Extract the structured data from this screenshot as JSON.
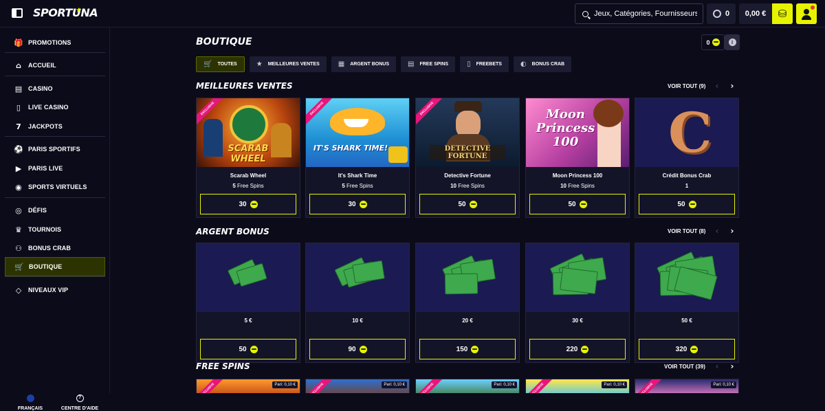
{
  "header": {
    "logo": "SPORTUNA",
    "search_placeholder": "Jeux, Catégories, Fournisseurs",
    "coins": "0",
    "balance": "0,00 €"
  },
  "sidebar": {
    "groups": [
      [
        {
          "label": "PROMOTIONS",
          "icon": "gift-icon"
        }
      ],
      [
        {
          "label": "ACCUEIL",
          "icon": "home-icon"
        }
      ],
      [
        {
          "label": "CASINO",
          "icon": "slot-icon"
        },
        {
          "label": "LIVE CASINO",
          "icon": "phone-icon"
        },
        {
          "label": "JACKPOTS",
          "icon": "seven-icon"
        }
      ],
      [
        {
          "label": "PARIS SPORTIFS",
          "icon": "ball-icon"
        },
        {
          "label": "PARIS LIVE",
          "icon": "video-icon"
        },
        {
          "label": "SPORTS VIRTUELS",
          "icon": "gamepad-icon"
        }
      ],
      [
        {
          "label": "DÉFIS",
          "icon": "target-icon"
        },
        {
          "label": "TOURNOIS",
          "icon": "trophy-icon"
        },
        {
          "label": "BONUS CRAB",
          "icon": "crab-icon"
        },
        {
          "label": "BOUTIQUE",
          "icon": "basket-icon"
        }
      ],
      [
        {
          "label": "NIVEAUX VIP",
          "icon": "diamond-icon"
        }
      ]
    ],
    "footer_language": "FRANÇAIS",
    "footer_help": "CENTRE D'AIDE"
  },
  "page": {
    "title": "BOUTIQUE",
    "wallet_count": "0",
    "tabs": [
      {
        "label": "TOUTES",
        "icon": "basket-icon",
        "active": true
      },
      {
        "label": "MEILLEURES VENTES",
        "icon": "star-icon",
        "active": false
      },
      {
        "label": "ARGENT BONUS",
        "icon": "cash-icon",
        "active": false
      },
      {
        "label": "FREE SPINS",
        "icon": "ticket-icon",
        "active": false
      },
      {
        "label": "FREEBETS",
        "icon": "slip-icon",
        "active": false
      },
      {
        "label": "BONUS CRAB",
        "icon": "crab-icon",
        "active": false
      }
    ]
  },
  "sections": {
    "best": {
      "title": "MEILLEURES VENTES",
      "voir": "VOIR TOUT (9)",
      "items": [
        {
          "name": "Scarab Wheel",
          "qty": "5",
          "unit": "Free Spins",
          "price": "30",
          "exclusive": "EXCLUSIVE"
        },
        {
          "name": "It's Shark Time",
          "qty": "5",
          "unit": "Free Spins",
          "price": "30",
          "exclusive": "EXCLUSIVE"
        },
        {
          "name": "Detective Fortune",
          "qty": "10",
          "unit": "Free Spins",
          "price": "50",
          "exclusive": "EXCLUSIVE"
        },
        {
          "name": "Moon Princess 100",
          "qty": "10",
          "unit": "Free Spins",
          "price": "50",
          "exclusive": ""
        },
        {
          "name": "Crédit Bonus Crab",
          "qty": "1",
          "unit": "",
          "price": "50",
          "exclusive": ""
        }
      ]
    },
    "money": {
      "title": "ARGENT BONUS",
      "voir": "VOIR TOUT (8)",
      "items": [
        {
          "name": "5 €",
          "price": "50"
        },
        {
          "name": "10 €",
          "price": "90"
        },
        {
          "name": "20 €",
          "price": "150"
        },
        {
          "name": "30 €",
          "price": "220"
        },
        {
          "name": "50 €",
          "price": "320"
        }
      ]
    },
    "spins": {
      "title": "FREE SPINS",
      "voir": "VOIR TOUT (39)",
      "items": [
        {
          "pari": "Pari: 0,10 €",
          "exclusive": "EXCLUSIVE"
        },
        {
          "pari": "Pari: 0,10 €",
          "exclusive": "EXCLUSIVE"
        },
        {
          "pari": "Pari: 0,10 €",
          "exclusive": "EXCLUSIVE"
        },
        {
          "pari": "Pari: 0,10 €",
          "exclusive": "EXCLUSIVE"
        },
        {
          "pari": "Pari: 0,10 €",
          "exclusive": "EXCLUSIVE"
        }
      ]
    }
  },
  "card_images": {
    "scarab": "SCARAB WHEEL",
    "shark": "IT'S SHARK TIME!",
    "detective": "DETECTIVE FORTUNE",
    "moon_1": "Moon",
    "moon_2": "Princess",
    "moon_3": "100",
    "crab": "C"
  },
  "colors": {
    "accent": "#e6f400",
    "background": "#0b0b1a",
    "card": "#141428",
    "exclusive": "#e8157a"
  }
}
